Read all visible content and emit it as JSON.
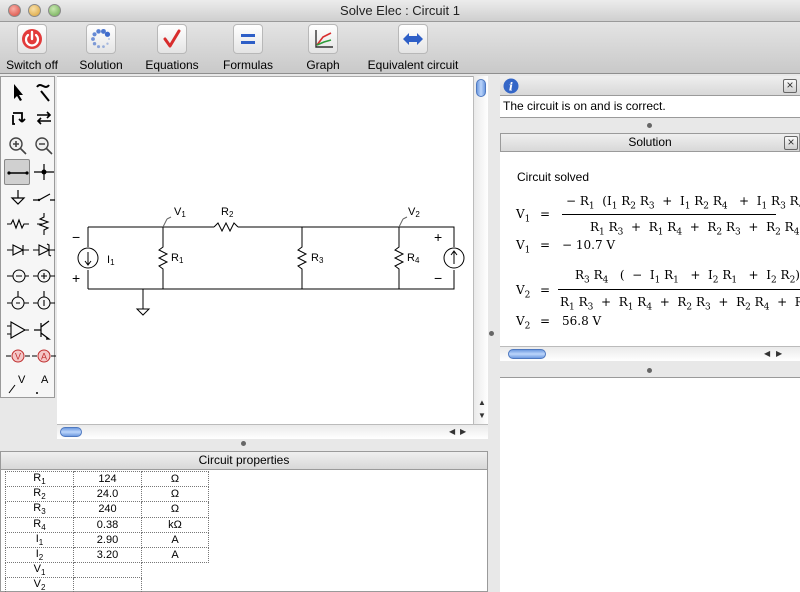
{
  "window": {
    "title": "Solve Elec : Circuit 1"
  },
  "toolbar": {
    "items": [
      {
        "label": "Switch off",
        "icon": "power-icon"
      },
      {
        "label": "Solution",
        "icon": "spinner-icon"
      },
      {
        "label": "Equations",
        "icon": "checkmark-icon"
      },
      {
        "label": "Formulas",
        "icon": "equals-icon"
      },
      {
        "label": "Graph",
        "icon": "graph-axes-icon"
      },
      {
        "label": "Equivalent circuit",
        "icon": "double-arrow-icon"
      }
    ]
  },
  "circuit": {
    "nodes": {
      "v1": "V",
      "v1_sub": "1",
      "v2": "V",
      "v2_sub": "2"
    },
    "components": {
      "r1": "R",
      "r1_sub": "1",
      "r2": "R",
      "r2_sub": "2",
      "r3": "R",
      "r3_sub": "3",
      "r4": "R",
      "r4_sub": "4",
      "i1": "I",
      "i1_sub": "1"
    },
    "polarity": {
      "minus": "−",
      "plus": "+"
    }
  },
  "palette": {
    "voltmeter": "V",
    "ammeter": "A",
    "probe_v": "V",
    "probe_a": "A"
  },
  "info": {
    "message": "The circuit is on and is correct."
  },
  "solution": {
    "title": "Solution",
    "status": "Circuit solved",
    "v1_value": "− 10.7 V",
    "v2_value": "56.8 V",
    "eq_sign": "=",
    "v1_numerator_prefix": "− R",
    "plus": "+",
    "minus": "−"
  },
  "properties": {
    "title": "Circuit properties",
    "rows": [
      {
        "name": "R",
        "sub": "1",
        "value": "124",
        "unit": "Ω"
      },
      {
        "name": "R",
        "sub": "2",
        "value": "24.0",
        "unit": "Ω"
      },
      {
        "name": "R",
        "sub": "3",
        "value": "240",
        "unit": "Ω"
      },
      {
        "name": "R",
        "sub": "4",
        "value": "0.38",
        "unit": "kΩ"
      },
      {
        "name": "I",
        "sub": "1",
        "value": "2.90",
        "unit": "A"
      },
      {
        "name": "I",
        "sub": "2",
        "value": "3.20",
        "unit": "A"
      },
      {
        "name": "V",
        "sub": "1",
        "value": "",
        "unit": ""
      },
      {
        "name": "V",
        "sub": "2",
        "value": "",
        "unit": ""
      }
    ]
  },
  "colors": {
    "accent": "#d82d2d",
    "scroll": "#6f9be0",
    "blue_icon": "#2e5fc7"
  }
}
